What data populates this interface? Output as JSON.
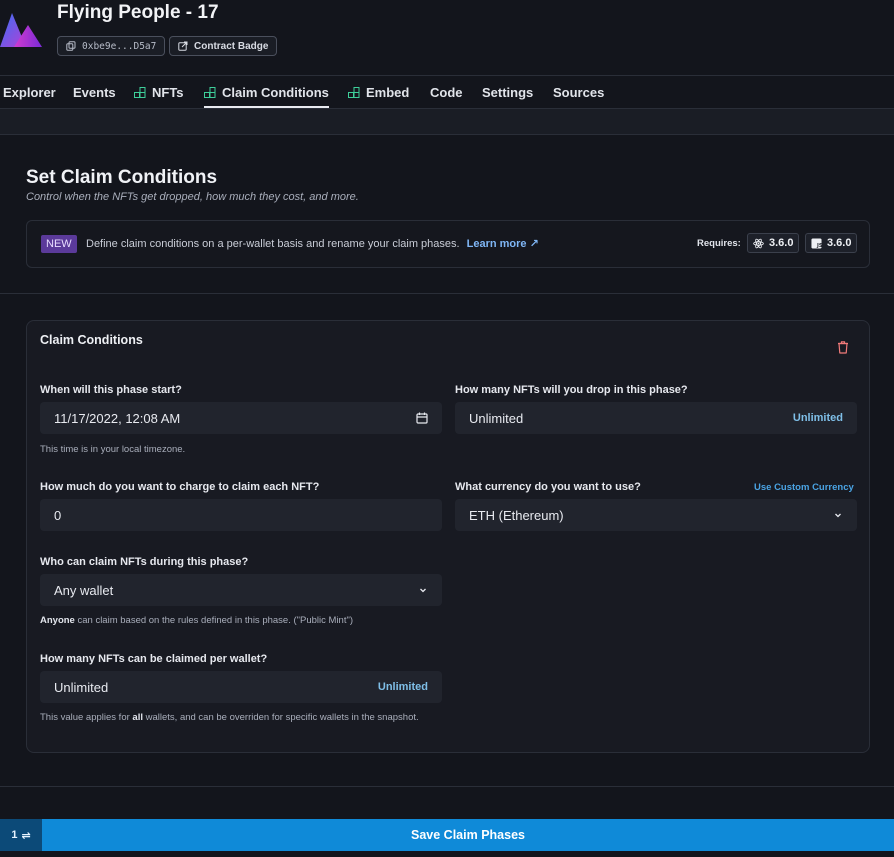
{
  "header": {
    "title": "Flying People - 17",
    "address": "0xbe9e...D5a7",
    "badge_label": "Contract Badge"
  },
  "tabs": [
    {
      "label": "Explorer",
      "icon": null
    },
    {
      "label": "Events",
      "icon": null
    },
    {
      "label": "NFTs",
      "icon": "blocks-icon"
    },
    {
      "label": "Claim Conditions",
      "icon": "blocks-icon",
      "active": true
    },
    {
      "label": "Embed",
      "icon": "blocks-icon"
    },
    {
      "label": "Code",
      "icon": null
    },
    {
      "label": "Settings",
      "icon": null
    },
    {
      "label": "Sources",
      "icon": null
    }
  ],
  "section": {
    "title": "Set Claim Conditions",
    "subtitle": "Control when the NFTs get dropped, how much they cost, and more."
  },
  "notice": {
    "badge": "NEW",
    "text": "Define claim conditions on a per-wallet basis and rename your claim phases.",
    "link": "Learn more",
    "link_arrow": "↗",
    "requires_label": "Requires:",
    "react_version": "3.6.0",
    "sdk_version": "3.6.0"
  },
  "card": {
    "title": "Claim Conditions",
    "start": {
      "label": "When will this phase start?",
      "value": "11/17/2022, 12:08 AM",
      "help": "This time is in your local timezone."
    },
    "drop": {
      "label": "How many NFTs will you drop in this phase?",
      "value": "Unlimited",
      "action": "Unlimited"
    },
    "price": {
      "label": "How much do you want to charge to claim each NFT?",
      "value": "0"
    },
    "currency": {
      "label": "What currency do you want to use?",
      "custom_link": "Use Custom Currency",
      "value": "ETH (Ethereum)"
    },
    "who": {
      "label": "Who can claim NFTs during this phase?",
      "value": "Any wallet",
      "help_bold": "Anyone",
      "help_rest": " can claim based on the rules defined in this phase. (\"Public Mint\")"
    },
    "per_wallet": {
      "label": "How many NFTs can be claimed per wallet?",
      "value": "Unlimited",
      "action": "Unlimited",
      "help_pre": "This value applies for ",
      "help_bold": "all",
      "help_post": " wallets, and can be overriden for specific wallets in the snapshot."
    }
  },
  "footer": {
    "count": "1",
    "count_icon": "⇌",
    "save_label": "Save Claim Phases"
  },
  "colors": {
    "background": "#13151c",
    "card": "#181a22",
    "accent": "#0f8ad8",
    "link": "#7fb6f5",
    "new_badge": "#5b3a9a"
  }
}
